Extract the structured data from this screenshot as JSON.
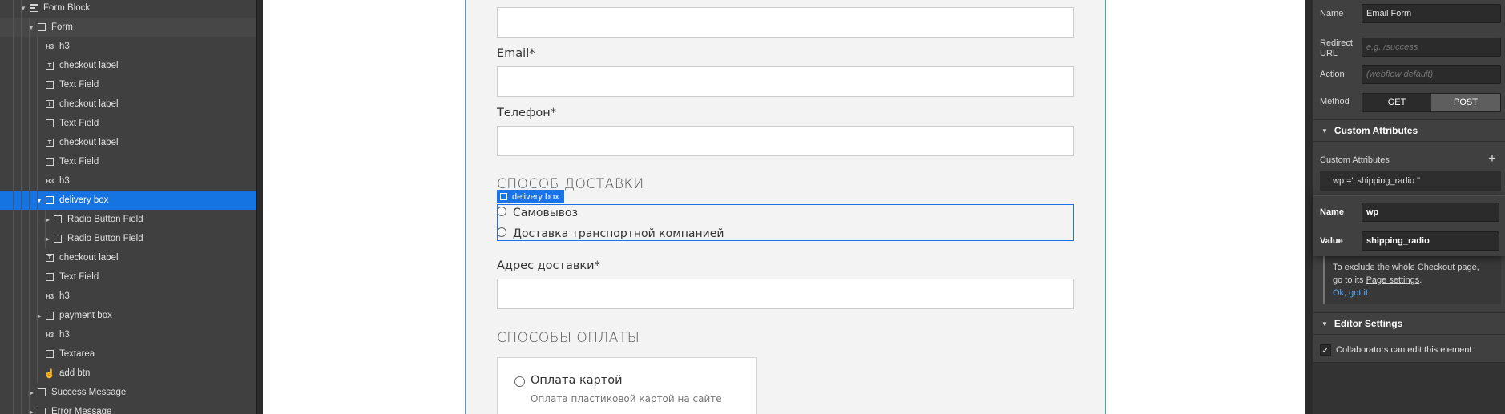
{
  "navigator": {
    "items": [
      {
        "label": "Form Block",
        "icon": "form-block-icon",
        "caret": "down"
      },
      {
        "label": "Form",
        "icon": "element-box-icon",
        "caret": "down"
      },
      {
        "label": "h3",
        "icon": "heading-h3-icon",
        "icon_text": "H3"
      },
      {
        "label": "checkout label",
        "icon": "text-label-icon",
        "icon_text": "T"
      },
      {
        "label": "Text Field",
        "icon": "element-box-icon"
      },
      {
        "label": "checkout label",
        "icon": "text-label-icon",
        "icon_text": "T"
      },
      {
        "label": "Text Field",
        "icon": "element-box-icon"
      },
      {
        "label": "checkout label",
        "icon": "text-label-icon",
        "icon_text": "T"
      },
      {
        "label": "Text Field",
        "icon": "element-box-icon"
      },
      {
        "label": "h3",
        "icon": "heading-h3-icon",
        "icon_text": "H3"
      },
      {
        "label": "delivery box",
        "icon": "element-box-icon",
        "caret": "down",
        "selected": true
      },
      {
        "label": "Radio Button Field",
        "icon": "element-box-icon",
        "caret": "right"
      },
      {
        "label": "Radio Button Field",
        "icon": "element-box-icon",
        "caret": "right"
      },
      {
        "label": "checkout label",
        "icon": "text-label-icon",
        "icon_text": "T"
      },
      {
        "label": "Text Field",
        "icon": "element-box-icon"
      },
      {
        "label": "h3",
        "icon": "heading-h3-icon",
        "icon_text": "H3"
      },
      {
        "label": "payment box",
        "icon": "element-box-icon",
        "caret": "right"
      },
      {
        "label": "h3",
        "icon": "heading-h3-icon",
        "icon_text": "H3"
      },
      {
        "label": "Textarea",
        "icon": "element-box-icon"
      },
      {
        "label": "add btn",
        "icon": "hand-pointer-icon"
      },
      {
        "label": "Success Message",
        "icon": "element-box-icon",
        "caret": "right"
      },
      {
        "label": "Error Message",
        "icon": "element-box-icon",
        "caret": "right"
      }
    ],
    "selected_color": "#1673e2"
  },
  "canvas": {
    "email_label": "Email*",
    "phone_label": "Телефон*",
    "delivery_heading": "СПОСОБ ДОСТАВКИ",
    "delivery_tag": "delivery box",
    "delivery_options": [
      "Самовывоз",
      "Доставка транспортной компанией"
    ],
    "address_label": "Адрес доставки*",
    "payment_heading": "СПОСОБЫ ОПЛАТЫ",
    "payment_option_title": "Оплата картой",
    "payment_option_desc": "Оплата пластиковой картой на сайте",
    "selection_color": "#1a73e8"
  },
  "settings": {
    "name_label": "Name",
    "name_value": "Email Form",
    "redirect_label": "Redirect URL",
    "redirect_placeholder": "e.g. /success",
    "action_label": "Action",
    "action_placeholder": "(webflow default)",
    "method_label": "Method",
    "method_options": [
      "GET",
      "POST"
    ],
    "method_selected": "POST",
    "custom_attributes_section": "Custom Attributes",
    "custom_attributes_label": "Custom Attributes",
    "add_icon": "plus-icon",
    "attribute_summary": "wp =\" shipping_radio \"",
    "popover": {
      "name_label": "Name",
      "name_value": "wp",
      "value_label": "Value",
      "value_value": "shipping_radio"
    },
    "notice_line1": "To exclude the whole Checkout page,",
    "notice_line2_prefix": "go to its ",
    "notice_link": "Page settings",
    "notice_line2_suffix": ".",
    "notice_ok": "Ok, got it",
    "editor_settings_section": "Editor Settings",
    "collaborators_label": "Collaborators can edit this element",
    "collaborators_checked": true
  }
}
